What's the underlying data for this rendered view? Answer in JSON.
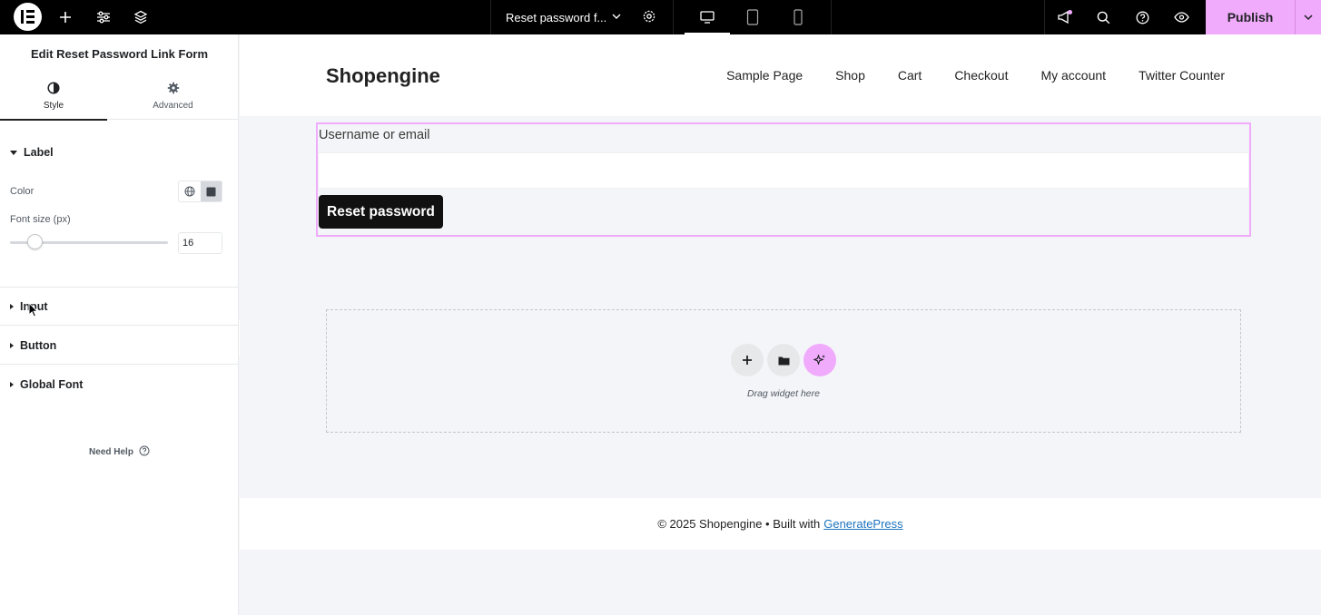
{
  "topbar": {
    "document_title": "Reset password f...",
    "publish_label": "Publish",
    "active_device": "desktop"
  },
  "panel": {
    "title": "Edit Reset Password Link Form",
    "tabs": [
      {
        "label": "Style",
        "icon": "half-circle-icon",
        "active": true
      },
      {
        "label": "Advanced",
        "icon": "gear-icon",
        "active": false
      }
    ],
    "sections": {
      "label": {
        "title": "Label",
        "expanded": true,
        "color_label": "Color",
        "font_size_label": "Font size (px)",
        "font_size_value": "16"
      },
      "input": {
        "title": "Input"
      },
      "button": {
        "title": "Button"
      },
      "global_font": {
        "title": "Global Font"
      }
    },
    "need_help": "Need Help"
  },
  "site": {
    "title": "Shopengine",
    "nav": [
      "Sample Page",
      "Shop",
      "Cart",
      "Checkout",
      "My account",
      "Twitter Counter"
    ],
    "form": {
      "label": "Username or email",
      "input_value": "",
      "button_label": "Reset password"
    },
    "drop_zone_text": "Drag widget here",
    "footer_text": "© 2025 Shopengine • Built with",
    "footer_link": "GeneratePress"
  },
  "colors": {
    "accent": "#f0abfc",
    "topbar_bg": "#000000",
    "link": "#1e73be"
  }
}
